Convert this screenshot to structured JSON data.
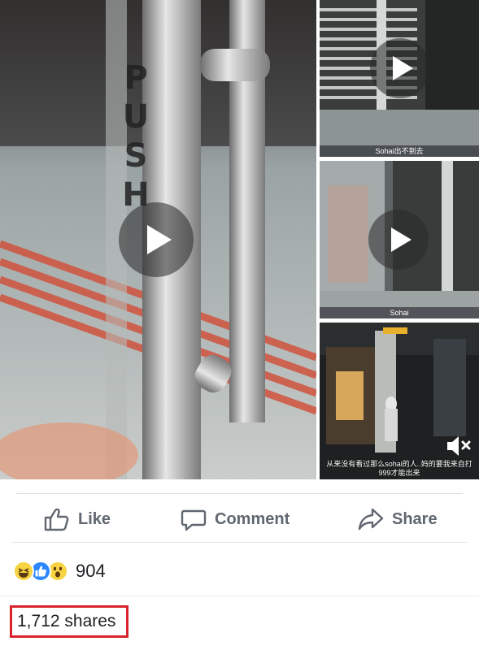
{
  "media": {
    "main_tile": {
      "door_sign_letters": [
        "P",
        "U",
        "S",
        "H"
      ]
    },
    "side_tiles": [
      {
        "caption": "Sohai出不到去"
      },
      {
        "caption": "Sohai"
      },
      {
        "subtitle_line1": "从来没有看过那么sohai的人..妈的要我来自打",
        "subtitle_line2": "999才能出来"
      }
    ]
  },
  "actions": {
    "like_label": "Like",
    "comment_label": "Comment",
    "share_label": "Share"
  },
  "reactions": {
    "icons": [
      "haha-icon",
      "like-icon",
      "wow-icon"
    ],
    "count": "904"
  },
  "shares": {
    "label": "1,712 shares"
  },
  "colors": {
    "action_text": "#606770",
    "like_blue": "#2d88ff",
    "emoji_yellow": "#f7d342",
    "highlight_red": "#d9232d"
  }
}
